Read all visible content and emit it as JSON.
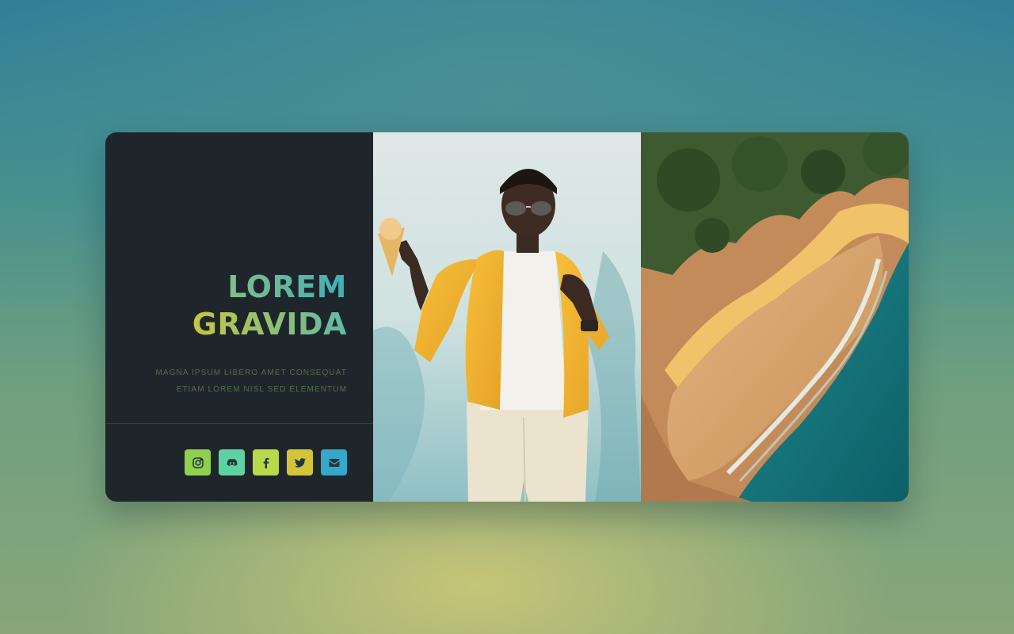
{
  "hero": {
    "title_line1": "LOREM",
    "title_line2": "GRAVIDA",
    "subtitle_line1": "MAGNA IPSUM LIBERO AMET CONSEQUAT",
    "subtitle_line2": "ETIAM LOREM NISL SED ELEMENTUM"
  },
  "social": {
    "items": [
      {
        "icon": "instagram-icon",
        "color": "#8fd14f"
      },
      {
        "icon": "discord-icon",
        "color": "#5ed2a0"
      },
      {
        "icon": "facebook-icon",
        "color": "#b7d94a"
      },
      {
        "icon": "twitter-icon",
        "color": "#d3c43a"
      },
      {
        "icon": "email-icon",
        "color": "#35a7c8"
      }
    ]
  },
  "colors": {
    "panel_bg": "#1f262b",
    "title_gradient_start": "#c7c63e",
    "title_gradient_end": "#3fb0b8"
  },
  "images": {
    "photo1": "person-yellow-jacket-ice-cream",
    "photo2": "aerial-beach-cliff-ocean"
  }
}
